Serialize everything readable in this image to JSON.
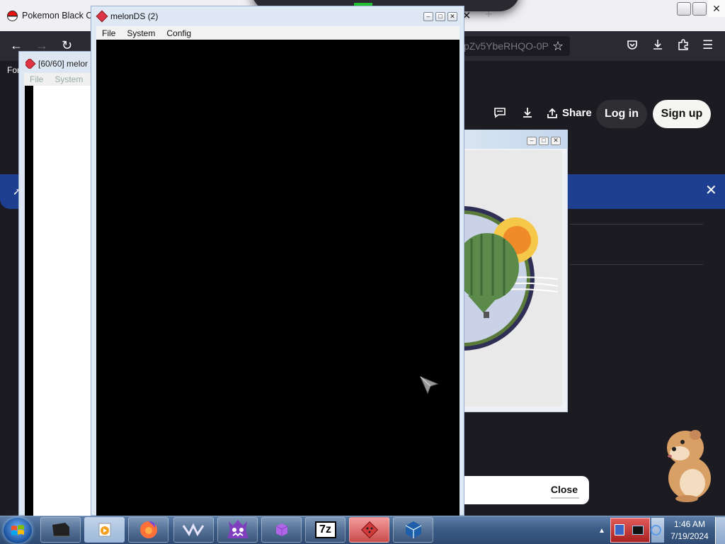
{
  "firefox": {
    "tab_title": "Pokemon Black Cl",
    "tab2_close": "✕",
    "new_tab": "+",
    "url_fragment": "pZv5YbeRHQO-0P",
    "bookmarks_label": "For",
    "page": {
      "share_label": "Share",
      "login_label": "Log in",
      "signup_label": "Sign up",
      "close_label": "Close"
    }
  },
  "melon_small": {
    "title": "[60/60] melor",
    "menu": [
      "File",
      "System"
    ]
  },
  "melon_main": {
    "title": "melonDS (2)",
    "menu": [
      "File",
      "System",
      "Config"
    ]
  },
  "taskbar": {
    "clock_time": "1:46 AM",
    "clock_date": "7/19/2024",
    "apps": [
      "media-center",
      "media-player",
      "firefox",
      "app-logo",
      "game-app",
      "cube-app",
      "7zip",
      "melonds",
      "virtualbox"
    ],
    "zip_label": "7z"
  },
  "colors": {
    "firefox_dark": "#1c1b22",
    "banner_blue": "#1e3f8f",
    "taskbar": "#3c5d87"
  }
}
